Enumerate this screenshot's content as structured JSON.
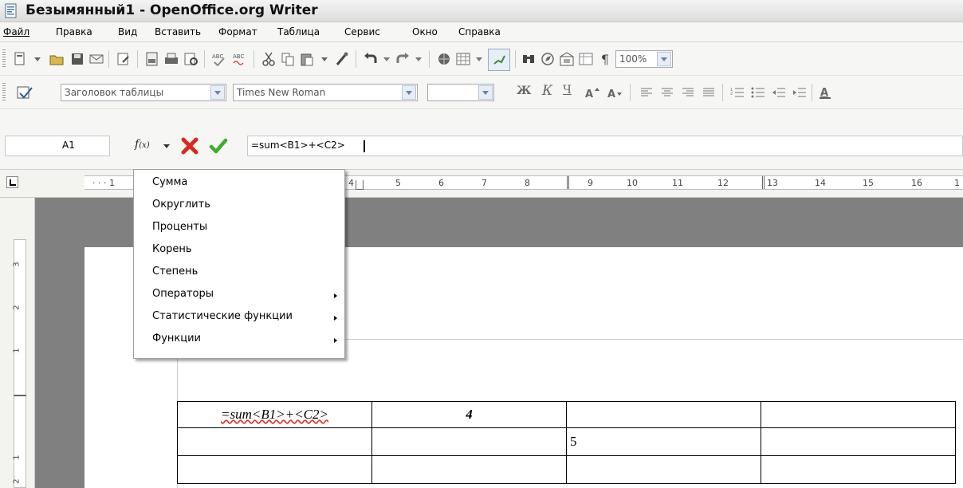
{
  "window": {
    "title": "Безымянный1 - OpenOffice.org Writer"
  },
  "menu": {
    "items": [
      "Файл",
      "Правка",
      "Вид",
      "Вставить",
      "Формат",
      "Таблица",
      "Сервис",
      "Окно",
      "Справка"
    ]
  },
  "format_toolbar": {
    "paragraph_style": "Заголовок таблицы",
    "font_name": "Times New Roman",
    "font_size": "",
    "bold_glyph": "Ж",
    "italic_glyph": "К",
    "underline_glyph": "Ч"
  },
  "standard_toolbar": {
    "zoom": "100%"
  },
  "formula_bar": {
    "cell_ref": "A1",
    "formula": "=sum<B1>+<C2>"
  },
  "ruler": {
    "h_numbers": [
      "1",
      "4",
      "5",
      "6",
      "7",
      "8",
      "9",
      "10",
      "11",
      "12",
      "13",
      "14",
      "15",
      "16",
      "1"
    ],
    "v_numbers": [
      "3",
      "2",
      "1",
      "1",
      "2"
    ]
  },
  "popup_menu": {
    "items": [
      {
        "label": "Сумма",
        "submenu": false
      },
      {
        "label": "Округлить",
        "submenu": false
      },
      {
        "label": "Проценты",
        "submenu": false
      },
      {
        "label": "Корень",
        "submenu": false
      },
      {
        "label": "Степень",
        "submenu": false
      },
      {
        "label": "Операторы",
        "submenu": true
      },
      {
        "label": "Статистические функции",
        "submenu": true
      },
      {
        "label": "Функции",
        "submenu": true
      }
    ]
  },
  "table": {
    "rows": [
      [
        "=sum<B1>+<C2>",
        "4",
        "",
        ""
      ],
      [
        "",
        "",
        "5",
        ""
      ],
      [
        "",
        "",
        "",
        ""
      ]
    ]
  },
  "colors": {
    "cancel": "#d62b1e",
    "accept": "#3fae2a",
    "doc_background": "#808080"
  }
}
